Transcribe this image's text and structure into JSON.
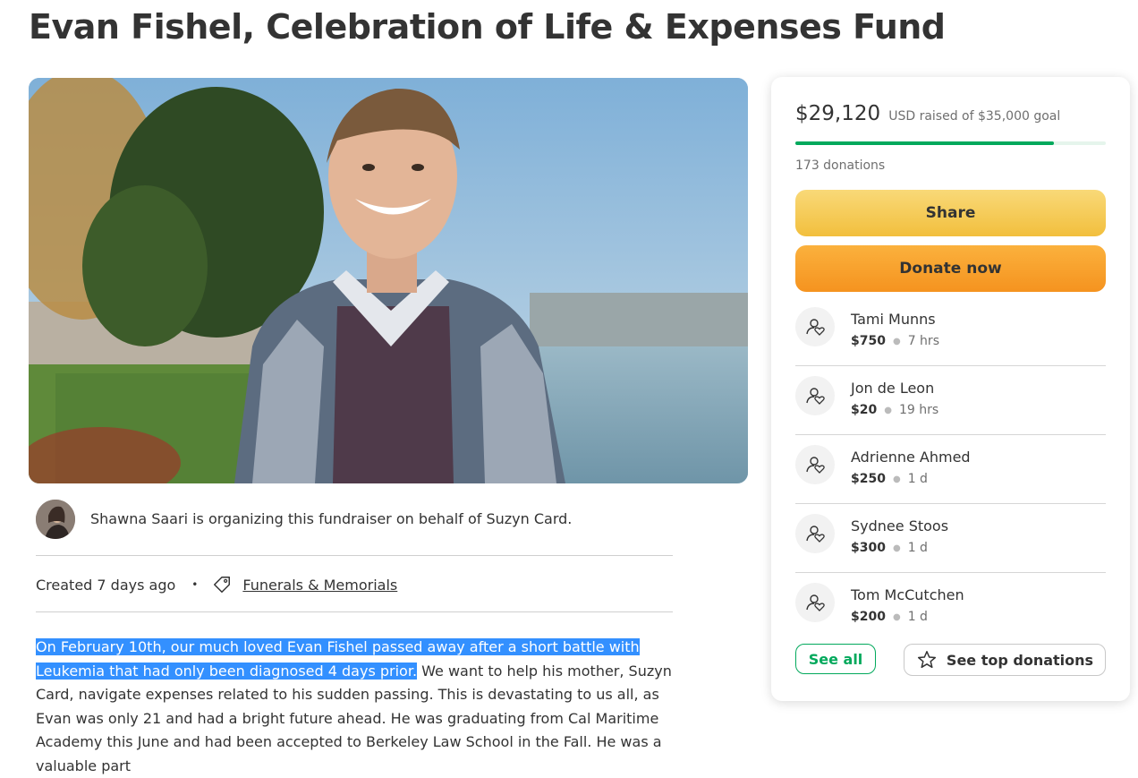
{
  "page": {
    "title": "Evan Fishel, Celebration of Life & Expenses Fund"
  },
  "organizer": {
    "text": "Shawna Saari is organizing this fundraiser on behalf of Suzyn Card."
  },
  "meta": {
    "created": "Created 7 days ago",
    "bullet": "•",
    "category": "Funerals & Memorials"
  },
  "story": {
    "highlighted": "On February 10th, our much loved Evan Fishel passed away after a short battle with Leukemia that had only been diagnosed 4 days prior.",
    "rest": " We want to help his mother, Suzyn Card, navigate expenses related to his sudden passing. This is devastating to us all, as Evan was only 21 and had a bright future ahead. He was graduating from Cal Maritime Academy this June and had been accepted to Berkeley Law School in the Fall. He was a valuable part"
  },
  "donation_card": {
    "raised": "$29,120",
    "goal_text": "USD raised of $35,000 goal",
    "progress_fraction": 0.832,
    "count": "173 donations",
    "share_label": "Share",
    "donate_label": "Donate now",
    "donors": [
      {
        "name": "Tami Munns",
        "amount": "$750",
        "time": "7 hrs"
      },
      {
        "name": "Jon de Leon",
        "amount": "$20",
        "time": "19 hrs"
      },
      {
        "name": "Adrienne Ahmed",
        "amount": "$250",
        "time": "1 d"
      },
      {
        "name": "Sydnee Stoos",
        "amount": "$300",
        "time": "1 d"
      },
      {
        "name": "Tom McCutchen",
        "amount": "$200",
        "time": "1 d"
      }
    ],
    "see_all_label": "See all",
    "see_top_label": "See top donations"
  },
  "colors": {
    "accent_green": "#02a95c",
    "share_yellow": "#f6c954",
    "donate_orange": "#f8a22e",
    "highlight_blue": "#3390ff"
  },
  "icons": {
    "tag": "tag-icon",
    "donor": "donor-heart-icon",
    "star": "star-icon"
  }
}
